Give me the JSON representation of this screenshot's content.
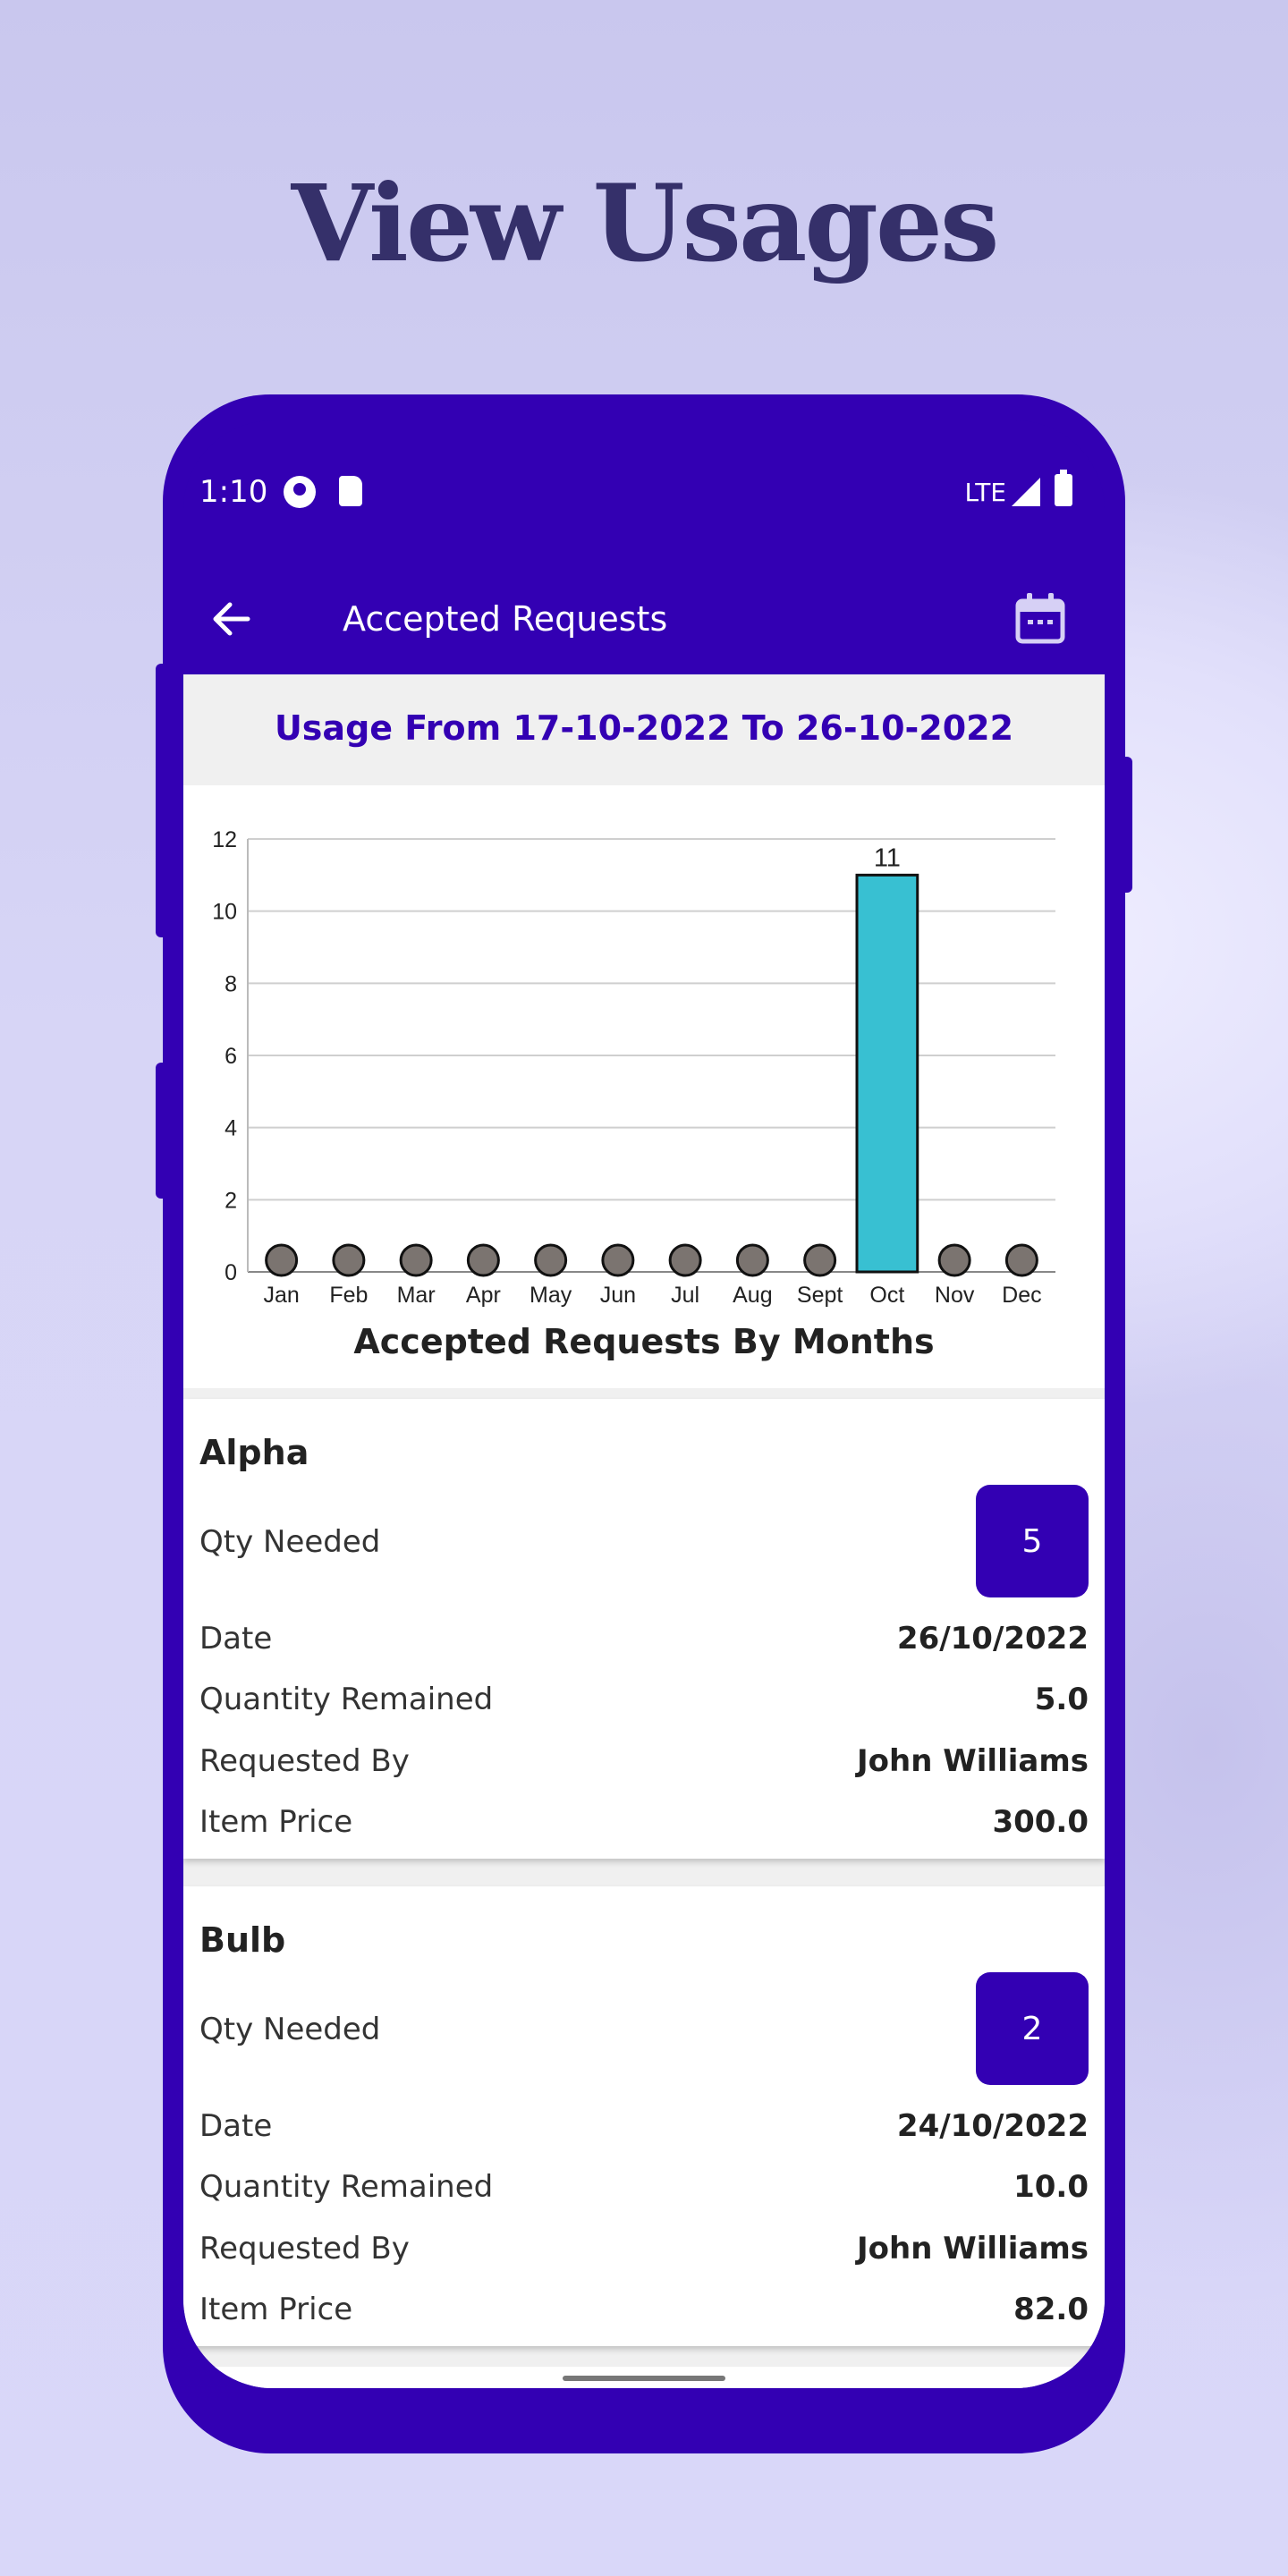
{
  "headline": "View Usages",
  "status_bar": {
    "time": "1:10",
    "network": "LTE"
  },
  "appbar": {
    "title": "Accepted Requests",
    "back_icon": "arrow-left-icon",
    "calendar_icon": "calendar-icon"
  },
  "usage_header": "Usage From 17-10-2022 To 26-10-2022",
  "chart_data": {
    "type": "bar",
    "title": "Accepted Requests By Months",
    "categories": [
      "Jan",
      "Feb",
      "Mar",
      "Apr",
      "May",
      "Jun",
      "Jul",
      "Aug",
      "Sept",
      "Oct",
      "Nov",
      "Dec"
    ],
    "values": [
      0,
      0,
      0,
      0,
      0,
      0,
      0,
      0,
      0,
      11,
      0,
      0
    ],
    "data_labels": [
      "",
      "",
      "",
      "",
      "",
      "",
      "",
      "",
      "",
      "11",
      "",
      ""
    ],
    "ylim": [
      0,
      12
    ],
    "yticks": [
      "0",
      "2",
      "4",
      "6",
      "8",
      "10",
      "12"
    ],
    "grid": true,
    "bar_color": "#38c0d2",
    "zero_marker_color": "#7b7470"
  },
  "labels": {
    "qty_needed": "Qty Needed",
    "date": "Date",
    "quantity_remained": "Quantity Remained",
    "requested_by": "Requested By",
    "item_price": "Item Price"
  },
  "requests": [
    {
      "name": "Alpha",
      "qty": "5",
      "date": "26/10/2022",
      "remained": "5.0",
      "requested_by": "John Williams",
      "price": "300.0"
    },
    {
      "name": "Bulb",
      "qty": "2",
      "date": "24/10/2022",
      "remained": "10.0",
      "requested_by": "John Williams",
      "price": "82.0"
    }
  ],
  "colors": {
    "primary": "#3300b3",
    "headline": "#35306a"
  }
}
